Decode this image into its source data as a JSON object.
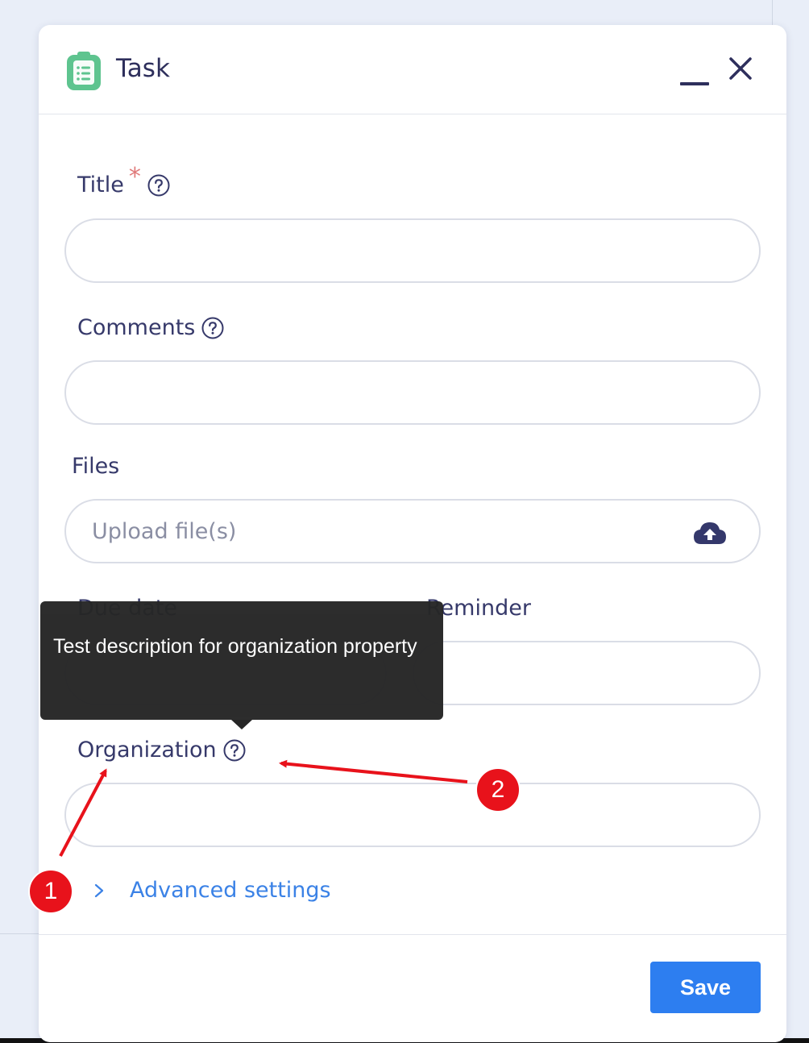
{
  "dialog": {
    "title": "Task",
    "app_icon": "clipboard-icon",
    "minimize_icon": "minimize-icon",
    "close_icon": "close-icon"
  },
  "form": {
    "title_label": "Title",
    "required_mark": "*",
    "comments_label": "Comments",
    "files_label": "Files",
    "upload_placeholder": "Upload file(s)",
    "due_date_label": "Due date",
    "reminder_label": "Reminder",
    "organization_label": "Organization",
    "advanced_settings_label": "Advanced settings"
  },
  "tooltip": {
    "text": "Test description for organization property"
  },
  "footer": {
    "save_label": "Save"
  },
  "annotations": {
    "badge_1": "1",
    "badge_2": "2",
    "color": "#e8121b"
  },
  "colors": {
    "accent": "#2d7ef0",
    "label_text": "#36396a",
    "link": "#3b82e6",
    "app_icon": "#5ec48f"
  }
}
